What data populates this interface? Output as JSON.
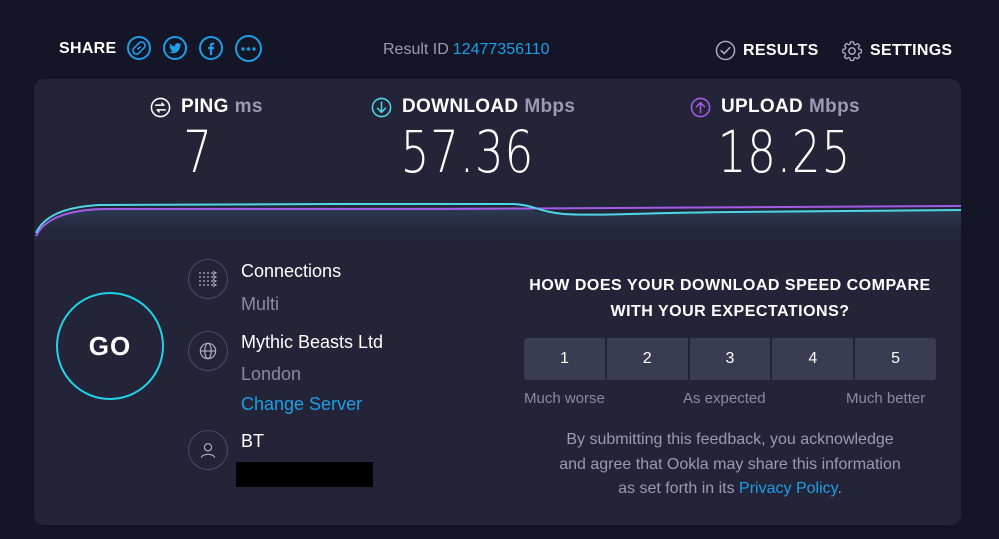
{
  "header": {
    "share_label": "SHARE",
    "share_icons": [
      "link-icon",
      "twitter-icon",
      "facebook-icon",
      "more-icon"
    ],
    "result_id_label": "Result ID",
    "result_id_value": "12477356110",
    "results_label": "RESULTS",
    "settings_label": "SETTINGS"
  },
  "metrics": {
    "ping": {
      "label": "PING",
      "unit": "ms",
      "value": "7"
    },
    "download": {
      "label": "DOWNLOAD",
      "unit": "Mbps",
      "value": "57.36"
    },
    "upload": {
      "label": "UPLOAD",
      "unit": "Mbps",
      "value": "18.25"
    }
  },
  "go_label": "GO",
  "connections": {
    "title": "Connections",
    "value": "Multi"
  },
  "server": {
    "name": "Mythic Beasts Ltd",
    "location": "London",
    "change_label": "Change Server"
  },
  "isp": {
    "name": "BT"
  },
  "feedback": {
    "question_line1": "HOW DOES YOUR DOWNLOAD SPEED COMPARE",
    "question_line2": "WITH YOUR EXPECTATIONS?",
    "ratings": [
      "1",
      "2",
      "3",
      "4",
      "5"
    ],
    "scale_low": "Much worse",
    "scale_mid": "As expected",
    "scale_high": "Much better",
    "disclaimer_line1": "By submitting this feedback, you acknowledge",
    "disclaimer_line2": "and agree that Ookla may share this information",
    "disclaimer_line3_prefix": "as set forth in its",
    "privacy_link": "Privacy Policy",
    "disclaimer_suffix": "."
  },
  "colors": {
    "accent": "#1e9ee8",
    "download_line": "#4fd6e6",
    "upload_line": "#a45ce8",
    "background": "#141526",
    "panel": "#232438"
  }
}
